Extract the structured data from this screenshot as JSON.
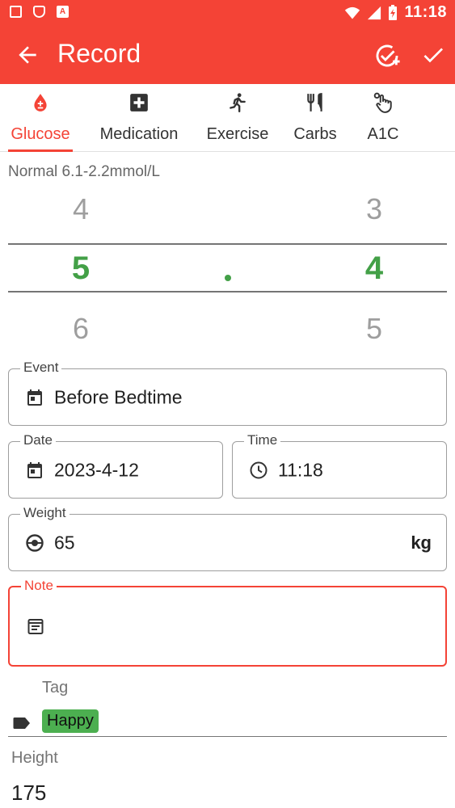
{
  "status_bar": {
    "time": "11:18",
    "left_icons": [
      "image-icon",
      "shield-icon",
      "a-icon"
    ],
    "right_icons": [
      "wifi-icon",
      "signal-icon",
      "battery-charging-icon"
    ],
    "a_letter": "A"
  },
  "app_bar": {
    "title": "Record",
    "back_icon": "arrow-back-icon",
    "actions": [
      "check-circle-add-icon",
      "check-icon"
    ],
    "color": "#f44336"
  },
  "tabs": [
    {
      "label": "Glucose",
      "icon": "blood-drop-icon",
      "active": true
    },
    {
      "label": "Medication",
      "icon": "medical-plus-icon",
      "active": false
    },
    {
      "label": "Exercise",
      "icon": "running-icon",
      "active": false
    },
    {
      "label": "Carbs",
      "icon": "fork-knife-icon",
      "active": false
    },
    {
      "label": "A1C",
      "icon": "finger-prick-icon",
      "active": false
    }
  ],
  "glucose": {
    "range_text": "Normal 6.1-2.2mmol/L",
    "integer_picker": {
      "above": "4",
      "selected": "5",
      "below": "6"
    },
    "decimal_picker": {
      "above": "3",
      "selected": "4",
      "below": "5"
    },
    "separator": ".",
    "accent_color": "#43a047"
  },
  "fields": {
    "event": {
      "label": "Event",
      "value": "Before Bedtime",
      "icon": "calendar-icon"
    },
    "date": {
      "label": "Date",
      "value": "2023-4-12",
      "icon": "calendar-icon"
    },
    "time": {
      "label": "Time",
      "value": "11:18",
      "icon": "clock-icon"
    },
    "weight": {
      "label": "Weight",
      "value": "65",
      "unit": "kg",
      "icon": "scale-icon"
    },
    "note": {
      "label": "Note",
      "value": "",
      "icon": "note-icon"
    }
  },
  "tag": {
    "label": "Tag",
    "icon": "label-icon",
    "chips": [
      "Happy"
    ],
    "chip_color": "#4caf50"
  },
  "height": {
    "label": "Height",
    "value": "175"
  }
}
